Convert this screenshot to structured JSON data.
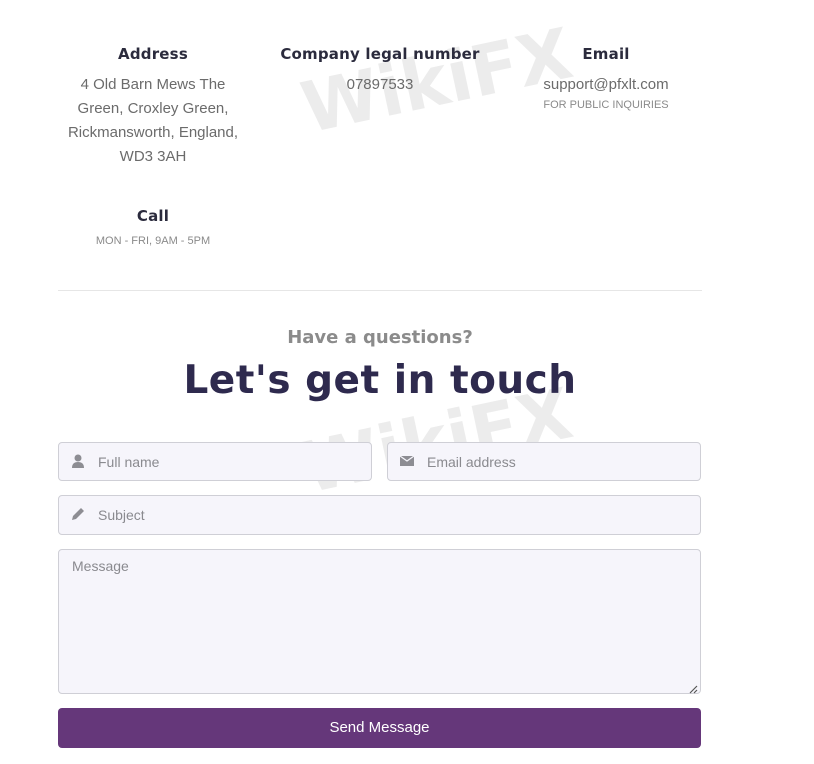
{
  "contact_info": {
    "address": {
      "title": "Address",
      "lines": [
        "4 Old Barn Mews The",
        "Green, Croxley Green,",
        "Rickmansworth, England,",
        "WD3 3AH"
      ]
    },
    "company": {
      "title": "Company legal number",
      "value": "07897533"
    },
    "email": {
      "title": "Email",
      "value": "support@pfxlt.com",
      "note": "FOR PUBLIC INQUIRIES"
    },
    "call": {
      "title": "Call",
      "note": "MON - FRI, 9AM - 5PM"
    }
  },
  "section": {
    "eyebrow": "Have a questions?",
    "headline_plain": "Let's ",
    "headline_highlight": "get in touch"
  },
  "form": {
    "full_name": {
      "placeholder": "Full name",
      "value": "",
      "icon": "user-icon"
    },
    "email": {
      "placeholder": "Email address",
      "value": "",
      "icon": "envelope-icon"
    },
    "subject": {
      "placeholder": "Subject",
      "value": "",
      "icon": "pencil-icon"
    },
    "message": {
      "placeholder": "Message",
      "value": ""
    },
    "submit_label": "Send Message"
  },
  "colors": {
    "accent": "#65377a",
    "heading": "#2e2a4e",
    "field_bg": "#f6f5fb"
  },
  "watermark": "WikiFX"
}
